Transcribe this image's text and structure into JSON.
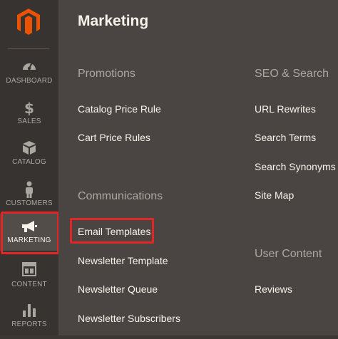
{
  "sidebar": {
    "items": [
      {
        "label": "DASHBOARD",
        "icon": "dashboard-icon"
      },
      {
        "label": "SALES",
        "icon": "dollar-icon"
      },
      {
        "label": "CATALOG",
        "icon": "box-icon"
      },
      {
        "label": "CUSTOMERS",
        "icon": "person-icon"
      },
      {
        "label": "MARKETING",
        "icon": "megaphone-icon",
        "active": true
      },
      {
        "label": "CONTENT",
        "icon": "layout-icon"
      },
      {
        "label": "REPORTS",
        "icon": "bar-chart-icon"
      }
    ]
  },
  "panel": {
    "title": "Marketing",
    "groups": {
      "promotions": {
        "title": "Promotions",
        "links": [
          "Catalog Price Rule",
          "Cart Price Rules"
        ]
      },
      "communications": {
        "title": "Communications",
        "links": [
          "Email Templates",
          "Newsletter Template",
          "Newsletter Queue",
          "Newsletter Subscribers"
        ]
      },
      "seo": {
        "title": "SEO & Search",
        "links": [
          "URL Rewrites",
          "Search Terms",
          "Search Synonyms",
          "Site Map"
        ]
      },
      "user_content": {
        "title": "User Content",
        "links": [
          "Reviews"
        ]
      }
    }
  },
  "colors": {
    "brand": "#eb5202",
    "highlight": "#e22626",
    "sidebar_bg": "#373330",
    "panel_bg": "#4a4542"
  }
}
